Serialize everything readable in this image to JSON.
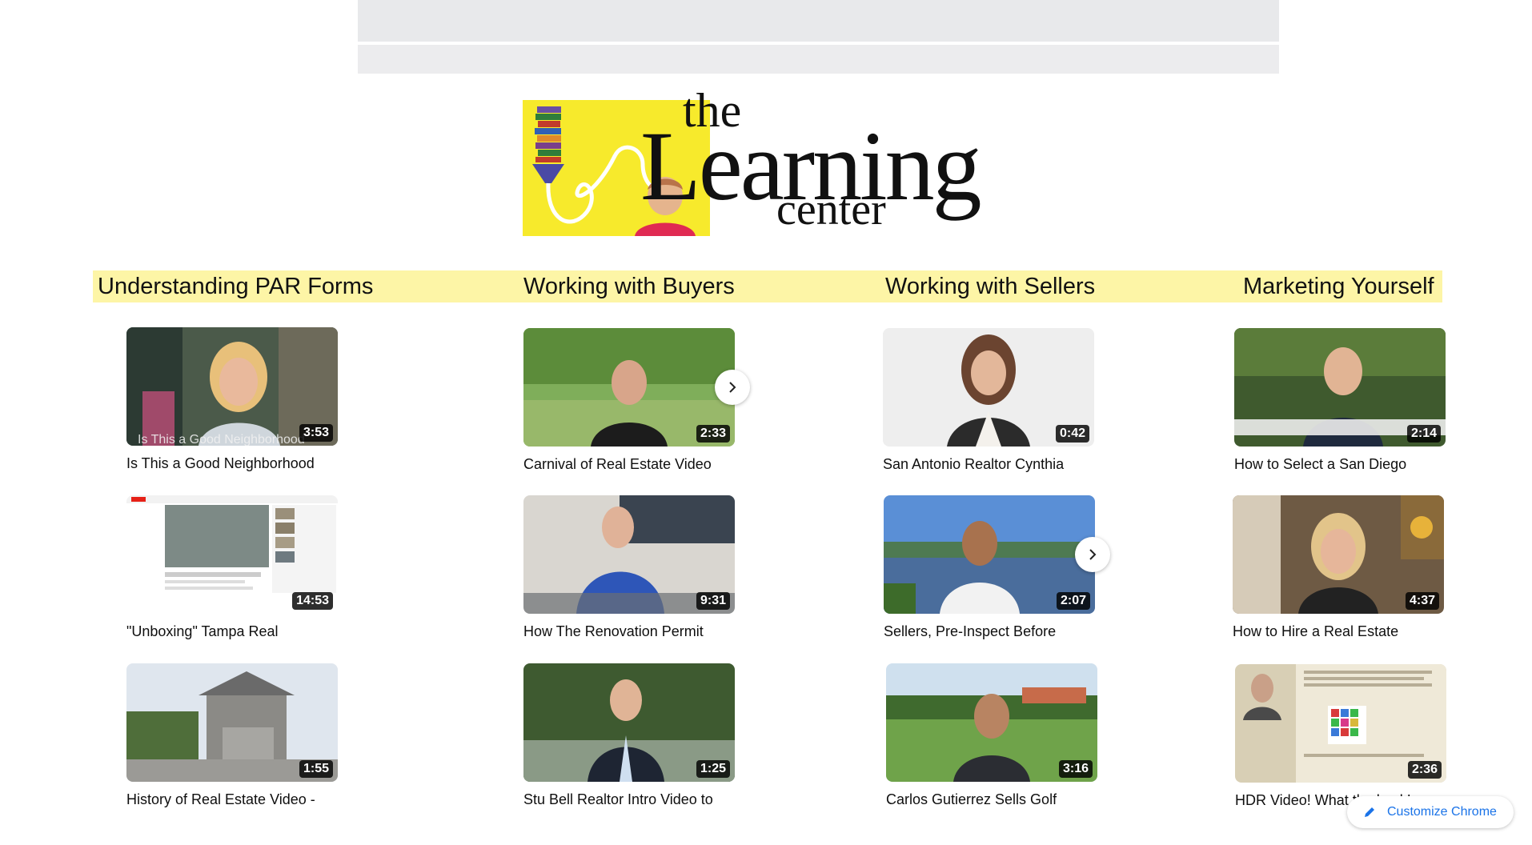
{
  "logo": {
    "line1": "the",
    "line2": "Learning",
    "line3": "center",
    "box_color": "#f7ea2c"
  },
  "categories": [
    "Understanding PAR Forms",
    "Working with Buyers",
    "Working with Sellers",
    "Marketing Yourself"
  ],
  "category_bar_color": "#fdf5a6",
  "videos": [
    {
      "title": "Is This a Good Neighborhood",
      "duration": "3:53",
      "caption": "Is This a Good Neighborhood"
    },
    {
      "title": "Carnival of Real Estate Video",
      "duration": "2:33"
    },
    {
      "title": "San Antonio Realtor Cynthia",
      "duration": "0:42"
    },
    {
      "title": "How to Select a San Diego",
      "duration": "2:14"
    },
    {
      "title": "\"Unboxing\" Tampa Real",
      "duration": "14:53"
    },
    {
      "title": "How The Renovation Permit",
      "duration": "9:31"
    },
    {
      "title": "Sellers, Pre-Inspect Before",
      "duration": "2:07"
    },
    {
      "title": "How to Hire a Real Estate",
      "duration": "4:37"
    },
    {
      "title": "History of Real Estate Video -",
      "duration": "1:55"
    },
    {
      "title": "Stu Bell Realtor Intro Video to",
      "duration": "1:25"
    },
    {
      "title": "Carlos Gutierrez Sells Golf",
      "duration": "3:16"
    },
    {
      "title": "HDR Video! What the heck!",
      "duration": "2:36"
    }
  ],
  "customize_chrome": {
    "label": "Customize Chrome",
    "icon": "pencil-icon"
  }
}
